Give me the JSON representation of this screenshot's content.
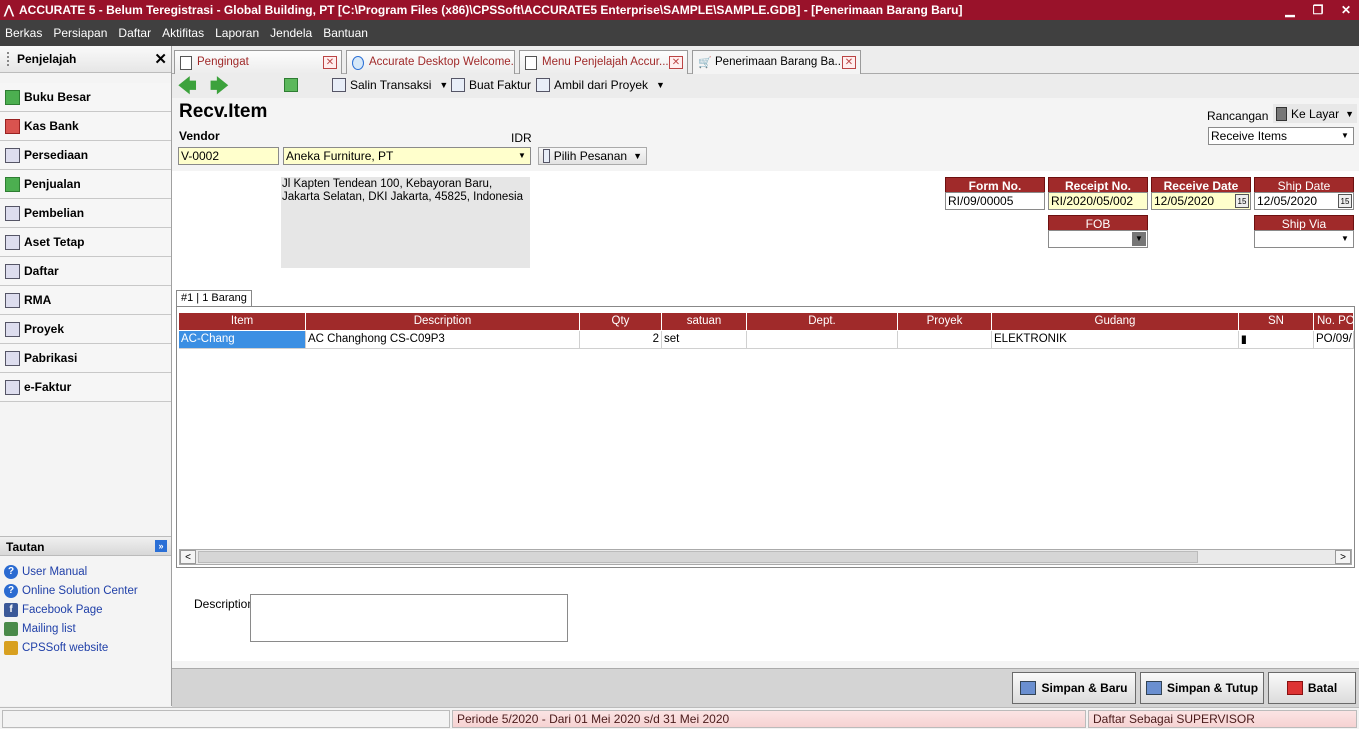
{
  "window": {
    "title": "ACCURATE 5  - Belum Teregistrasi - Global Building, PT   [C:\\Program Files (x86)\\CPSSoft\\ACCURATE5 Enterprise\\SAMPLE\\SAMPLE.GDB] - [Penerimaan Barang Baru]",
    "minimize": "▁",
    "restore": "❐",
    "close": "✕"
  },
  "menu": [
    "Berkas",
    "Persiapan",
    "Daftar",
    "Aktifitas",
    "Laporan",
    "Jendela",
    "Bantuan"
  ],
  "sidebar": {
    "title": "Penjelajah",
    "close": "✕",
    "items": [
      {
        "label": "Buku Besar",
        "icon": "ledger-icon"
      },
      {
        "label": "Kas Bank",
        "icon": "cash-bank-icon"
      },
      {
        "label": "Persediaan",
        "icon": "inventory-icon"
      },
      {
        "label": "Penjualan",
        "icon": "sales-icon"
      },
      {
        "label": "Pembelian",
        "icon": "cart-icon"
      },
      {
        "label": "Aset Tetap",
        "icon": "house-icon"
      },
      {
        "label": "Daftar",
        "icon": "list-icon"
      },
      {
        "label": "RMA",
        "icon": "rma-icon"
      },
      {
        "label": "Proyek",
        "icon": "project-icon"
      },
      {
        "label": "Pabrikasi",
        "icon": "factory-icon"
      },
      {
        "label": "e-Faktur",
        "icon": "efaktur-icon"
      }
    ],
    "tautan_title": "Tautan",
    "links": [
      "User Manual",
      "Online Solution Center",
      "Facebook Page",
      "Mailing list",
      "CPSSoft website"
    ]
  },
  "tabs": [
    {
      "label": "Pengingat",
      "active": false
    },
    {
      "label": "Accurate Desktop Welcome...",
      "active": false
    },
    {
      "label": "Menu Penjelajah Accur...",
      "active": false
    },
    {
      "label": "Penerimaan Barang Ba...",
      "active": true
    }
  ],
  "toolbar": {
    "salin": "Salin Transaksi",
    "buat": "Buat Faktur",
    "ambil": "Ambil dari Proyek"
  },
  "form": {
    "title": "Recv.Item",
    "vendor_label": "Vendor",
    "currency": "IDR",
    "vendor_code": "V-0002",
    "vendor_name": "Aneka Furniture, PT",
    "pilih_pesanan": "Pilih Pesanan",
    "rancangan_label": "Rancangan",
    "ke_layar": "Ke Layar",
    "template": "Receive Items",
    "address": "Jl Kapten Tendean 100, Kebayoran Baru, Jakarta Selatan, DKI Jakarta, 45825, Indonesia",
    "form_no_label": "Form No.",
    "form_no": "RI/09/00005",
    "receipt_no_label": "Receipt No.",
    "receipt_no": "RI/2020/05/002",
    "receive_date_label": "Receive Date",
    "receive_date": "12/05/2020",
    "ship_date_label": "Ship Date",
    "ship_date": "12/05/2020",
    "fob_label": "FOB",
    "fob": "",
    "ship_via_label": "Ship Via",
    "ship_via": "",
    "calendar_glyph": "15",
    "grid_tab": "#1 | 1 Barang",
    "description_label": "Description",
    "description": ""
  },
  "grid": {
    "columns": [
      "Item",
      "Description",
      "Qty",
      "satuan",
      "Dept.",
      "Proyek",
      "Gudang",
      "SN",
      "No. PO"
    ],
    "rows": [
      {
        "item": "AC-Chang",
        "description": "AC Changhong CS-C09P3",
        "qty": "2",
        "satuan": "set",
        "dept": "",
        "proyek": "",
        "gudang": "ELEKTRONIK",
        "sn": "|||||||||||",
        "po": "PO/09/"
      }
    ]
  },
  "buttons": {
    "simpan_baru": "Simpan & Baru",
    "simpan_tutup": "Simpan & Tutup",
    "batal": "Batal"
  },
  "status": {
    "periode": "Periode 5/2020 - Dari 01 Mei 2020 s/d 31 Mei 2020",
    "user": "Daftar Sebagai SUPERVISOR"
  },
  "colors": {
    "title_bar": "#99122a",
    "menu_bar": "#404040",
    "header_red": "#a02a2a",
    "input_yellow": "#ffffcc",
    "selection_blue": "#3b8fe3"
  }
}
